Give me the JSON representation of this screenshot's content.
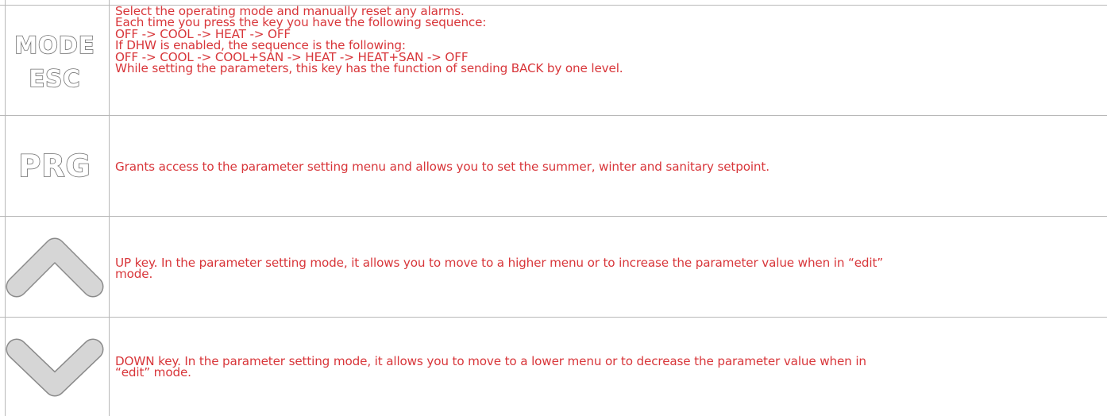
{
  "rows": [
    {
      "key": "mode-esc",
      "icon_labels": [
        "MODE",
        "ESC"
      ],
      "lines": [
        "Select the operating mode and manually reset any alarms.",
        "Each time you press the key you have the following sequence:",
        "OFF -> COOL -> HEAT -> OFF",
        "If DHW is enabled, the sequence is the following:",
        "OFF -> COOL -> COOL+SAN -> HEAT -> HEAT+SAN -> OFF",
        "While setting the parameters, this key has the function of sending BACK by one level."
      ]
    },
    {
      "key": "prg",
      "icon_labels": [
        "PRG"
      ],
      "lines": [
        "Grants access to the parameter setting menu and allows you to set the summer, winter and sanitary setpoint."
      ]
    },
    {
      "key": "up",
      "icon_name": "chevron-up-icon",
      "lines": [
        "UP key. In the parameter setting mode, it allows you to move to a higher menu or to increase the parameter value when in “edit”",
        "mode."
      ]
    },
    {
      "key": "down",
      "icon_name": "chevron-down-icon",
      "lines": [
        "DOWN key. In the parameter setting mode, it allows you to move to a lower menu or to decrease the parameter value when in",
        "“edit” mode."
      ]
    }
  ],
  "colors": {
    "text": "#d8363a",
    "grid": "#b8b8b8",
    "key_fill": "#d6d6d6",
    "key_stroke": "#8a8a8a"
  }
}
